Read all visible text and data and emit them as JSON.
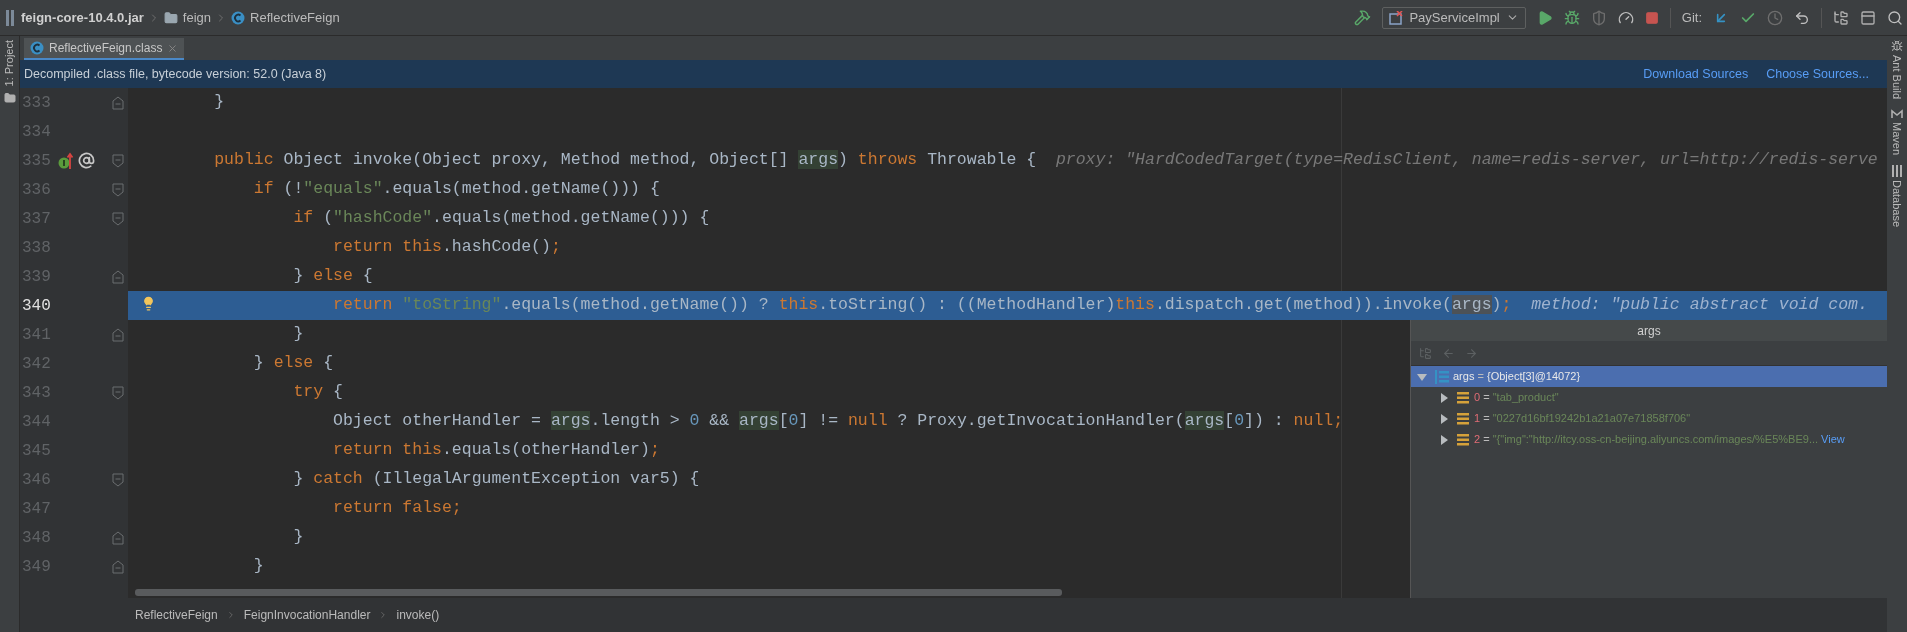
{
  "navigation_bar": {
    "breadcrumbs": [
      {
        "label": "feign-core-10.4.0.jar",
        "kind": "jar"
      },
      {
        "label": "feign",
        "kind": "folder"
      },
      {
        "label": "ReflectiveFeign",
        "kind": "class"
      }
    ],
    "run_configuration": "PayServiceImpl",
    "vcs_label": "Git:"
  },
  "left_tool_strip": {
    "tabs": [
      "1: Project"
    ]
  },
  "right_tool_strip": {
    "tabs": [
      "Ant Build",
      "Maven",
      "Database"
    ]
  },
  "editor_tabs": [
    {
      "label": "ReflectiveFeign.class",
      "selected": true
    }
  ],
  "notice": {
    "text": "Decompiled .class file, bytecode version: 52.0 (Java 8)",
    "links": [
      "Download Sources",
      "Choose Sources..."
    ]
  },
  "code_lines": [
    {
      "number": "333",
      "selected": false,
      "fold": {
        "kind": "end"
      },
      "tokens": [
        {
          "kind": "plain",
          "text": "        }"
        }
      ]
    },
    {
      "number": "334",
      "selected": false
    },
    {
      "number": "335",
      "selected": false,
      "fold": {
        "kind": "start"
      },
      "marker": {
        "kind": "implements"
      },
      "tokens": [
        {
          "kind": "keyword",
          "text": "        public"
        },
        {
          "kind": "plain",
          "text": " Object invoke(Object proxy, Method method, Object[] "
        },
        {
          "kind": "param",
          "text": "args"
        },
        {
          "kind": "plain",
          "text": ") "
        },
        {
          "kind": "keyword",
          "text": "throws"
        },
        {
          "kind": "plain",
          "text": " Throwable {  "
        },
        {
          "kind": "hint",
          "text": "proxy: \"HardCodedTarget(type=RedisClient, name=redis-server, url=http://redis-serve"
        }
      ]
    },
    {
      "number": "336",
      "selected": false,
      "fold": {
        "kind": "start"
      },
      "tokens": [
        {
          "kind": "keyword",
          "text": "            if"
        },
        {
          "kind": "plain",
          "text": " (!"
        },
        {
          "kind": "string",
          "text": "\"equals\""
        },
        {
          "kind": "plain",
          "text": ".equals(method.getName())) {"
        }
      ]
    },
    {
      "number": "337",
      "selected": false,
      "fold": {
        "kind": "start"
      },
      "tokens": [
        {
          "kind": "keyword",
          "text": "                if"
        },
        {
          "kind": "plain",
          "text": " ("
        },
        {
          "kind": "string",
          "text": "\"hashCode\""
        },
        {
          "kind": "plain",
          "text": ".equals(method.getName())) {"
        }
      ]
    },
    {
      "number": "338",
      "selected": false,
      "tokens": [
        {
          "kind": "keyword",
          "text": "                    return this"
        },
        {
          "kind": "plain",
          "text": ".hashCode()"
        },
        {
          "kind": "keyword",
          "text": ";"
        }
      ]
    },
    {
      "number": "339",
      "selected": false,
      "fold": {
        "kind": "end"
      },
      "tokens": [
        {
          "kind": "plain",
          "text": "                } "
        },
        {
          "kind": "keyword",
          "text": "else"
        },
        {
          "kind": "plain",
          "text": " {"
        }
      ]
    },
    {
      "number": "340",
      "selected": true,
      "marker": {
        "kind": "intention"
      },
      "tokens": [
        {
          "kind": "keyword",
          "text": "                    return "
        },
        {
          "kind": "string",
          "text": "\"toString\""
        },
        {
          "kind": "plain",
          "text": ".equals(method.getName()) ? "
        },
        {
          "kind": "keyword",
          "text": "this"
        },
        {
          "kind": "plain",
          "text": ".toString() : ((MethodHandler)"
        },
        {
          "kind": "keyword",
          "text": "this"
        },
        {
          "kind": "plain",
          "text": ".dispatch.get(method)).invoke("
        },
        {
          "kind": "param",
          "text": "args"
        },
        {
          "kind": "plain",
          "text": ")"
        },
        {
          "kind": "keyword",
          "text": ";  "
        },
        {
          "kind": "hint",
          "text": "method: \"public abstract void com."
        }
      ]
    },
    {
      "number": "341",
      "selected": false,
      "fold": {
        "kind": "end"
      },
      "tokens": [
        {
          "kind": "plain",
          "text": "                }"
        }
      ]
    },
    {
      "number": "342",
      "selected": false,
      "tokens": [
        {
          "kind": "plain",
          "text": "            } "
        },
        {
          "kind": "keyword",
          "text": "else"
        },
        {
          "kind": "plain",
          "text": " {"
        }
      ]
    },
    {
      "number": "343",
      "selected": false,
      "fold": {
        "kind": "start"
      },
      "tokens": [
        {
          "kind": "keyword",
          "text": "                try"
        },
        {
          "kind": "plain",
          "text": " {"
        }
      ]
    },
    {
      "number": "344",
      "selected": false,
      "tokens": [
        {
          "kind": "plain",
          "text": "                    Object otherHandler = "
        },
        {
          "kind": "param",
          "text": "args"
        },
        {
          "kind": "plain",
          "text": ".length > "
        },
        {
          "kind": "number",
          "text": "0"
        },
        {
          "kind": "plain",
          "text": " && "
        },
        {
          "kind": "param",
          "text": "args"
        },
        {
          "kind": "plain",
          "text": "["
        },
        {
          "kind": "number",
          "text": "0"
        },
        {
          "kind": "plain",
          "text": "] != "
        },
        {
          "kind": "keyword",
          "text": "null"
        },
        {
          "kind": "plain",
          "text": " ? Proxy.getInvocationHandler("
        },
        {
          "kind": "param",
          "text": "args"
        },
        {
          "kind": "plain",
          "text": "["
        },
        {
          "kind": "number",
          "text": "0"
        },
        {
          "kind": "plain",
          "text": "]) : "
        },
        {
          "kind": "keyword",
          "text": "null;"
        }
      ]
    },
    {
      "number": "345",
      "selected": false,
      "tokens": [
        {
          "kind": "keyword",
          "text": "                    return this"
        },
        {
          "kind": "plain",
          "text": ".equals(otherHandler)"
        },
        {
          "kind": "keyword",
          "text": ";"
        }
      ]
    },
    {
      "number": "346",
      "selected": false,
      "fold": {
        "kind": "start"
      },
      "tokens": [
        {
          "kind": "plain",
          "text": "                } "
        },
        {
          "kind": "keyword",
          "text": "catch"
        },
        {
          "kind": "plain",
          "text": " (IllegalArgumentException var5) {"
        }
      ]
    },
    {
      "number": "347",
      "selected": false,
      "tokens": [
        {
          "kind": "keyword",
          "text": "                    return false;"
        }
      ]
    },
    {
      "number": "348",
      "selected": false,
      "fold": {
        "kind": "end"
      },
      "tokens": [
        {
          "kind": "plain",
          "text": "                }"
        }
      ]
    },
    {
      "number": "349",
      "selected": false,
      "fold": {
        "kind": "end"
      },
      "tokens": [
        {
          "kind": "plain",
          "text": "            }"
        }
      ]
    }
  ],
  "popup": {
    "title": "args",
    "tree": [
      {
        "name": "args",
        "operator": "=",
        "value": "{Object[3]@14072}",
        "kind": "array",
        "expanded": true,
        "selected": true,
        "children": [
          {
            "name": "0",
            "operator": "=",
            "value": "\"tab_product\"",
            "kind": "string",
            "expanded": false,
            "selected": false
          },
          {
            "name": "1",
            "operator": "=",
            "value": "\"0227d16bf19242b1a21a07e71858f706\"",
            "kind": "string",
            "expanded": false,
            "selected": false
          },
          {
            "name": "2",
            "operator": "=",
            "value": "\"{\"img\":\"http://itcy.oss-cn-beijing.aliyuncs.com/images/%E5%BE9...",
            "kind": "string",
            "expanded": false,
            "selected": false,
            "link": "View"
          }
        ]
      }
    ]
  },
  "breadcrumb_bar": [
    "ReflectiveFeign",
    "FeignInvocationHandler",
    "invoke()"
  ]
}
